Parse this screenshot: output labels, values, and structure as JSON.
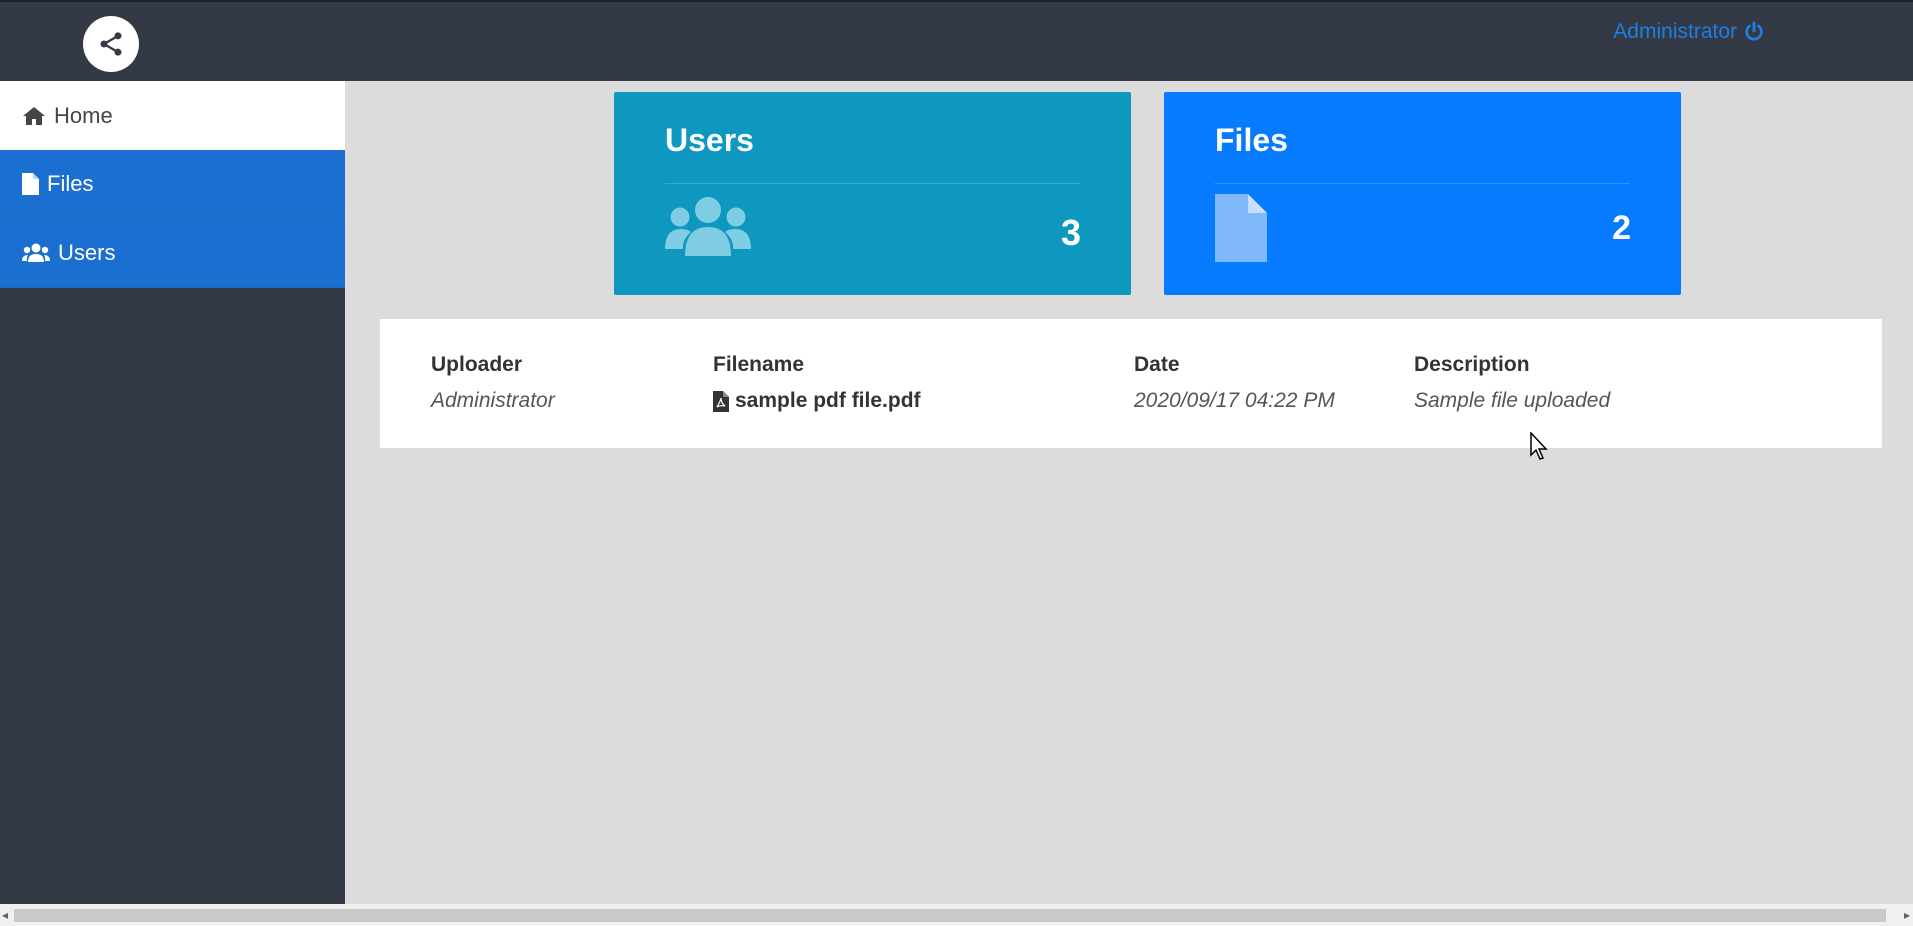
{
  "header": {
    "logo_icon": "share-icon",
    "user_label": "Administrator",
    "power_icon": "power-icon",
    "accent_color": "#1e7fe0"
  },
  "sidebar": {
    "items": [
      {
        "label": "Home",
        "icon": "home-icon",
        "active": true
      },
      {
        "label": "Files",
        "icon": "file-icon",
        "active": false
      },
      {
        "label": "Users",
        "icon": "users-icon",
        "active": false
      }
    ]
  },
  "cards": {
    "users": {
      "title": "Users",
      "count": "3",
      "icon": "users-icon",
      "color": "#0f98bf"
    },
    "files": {
      "title": "Files",
      "count": "2",
      "icon": "file-icon",
      "color": "#077bfd"
    }
  },
  "table": {
    "headers": [
      "Uploader",
      "Filename",
      "Date",
      "Description"
    ],
    "rows": [
      {
        "uploader": "Administrator",
        "filename": "sample pdf file.pdf",
        "date": "2020/09/17 04:22 PM",
        "description": "Sample file uploaded"
      }
    ]
  }
}
